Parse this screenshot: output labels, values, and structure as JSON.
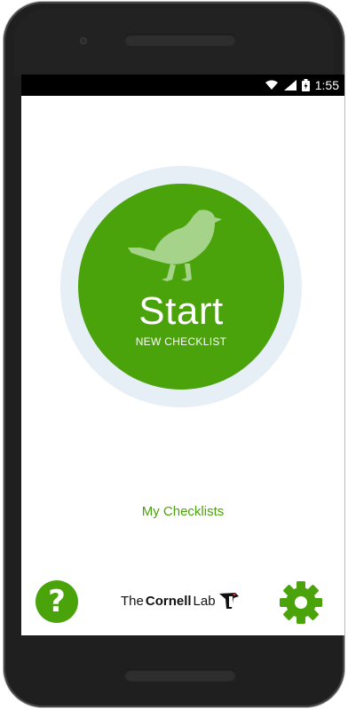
{
  "statusbar": {
    "time": "1:55"
  },
  "start_button": {
    "label": "Start",
    "sublabel": "NEW CHECKLIST"
  },
  "links": {
    "my_checklists": "My Checklists"
  },
  "footer": {
    "logo": {
      "the": "The",
      "cornell": "Cornell",
      "lab": "Lab"
    },
    "help_icon": "question-circle-icon",
    "settings_icon": "gear-icon"
  },
  "colors": {
    "accent": "#4aa30a",
    "ring": "#e6eef6",
    "bird": "#a6d38a"
  }
}
